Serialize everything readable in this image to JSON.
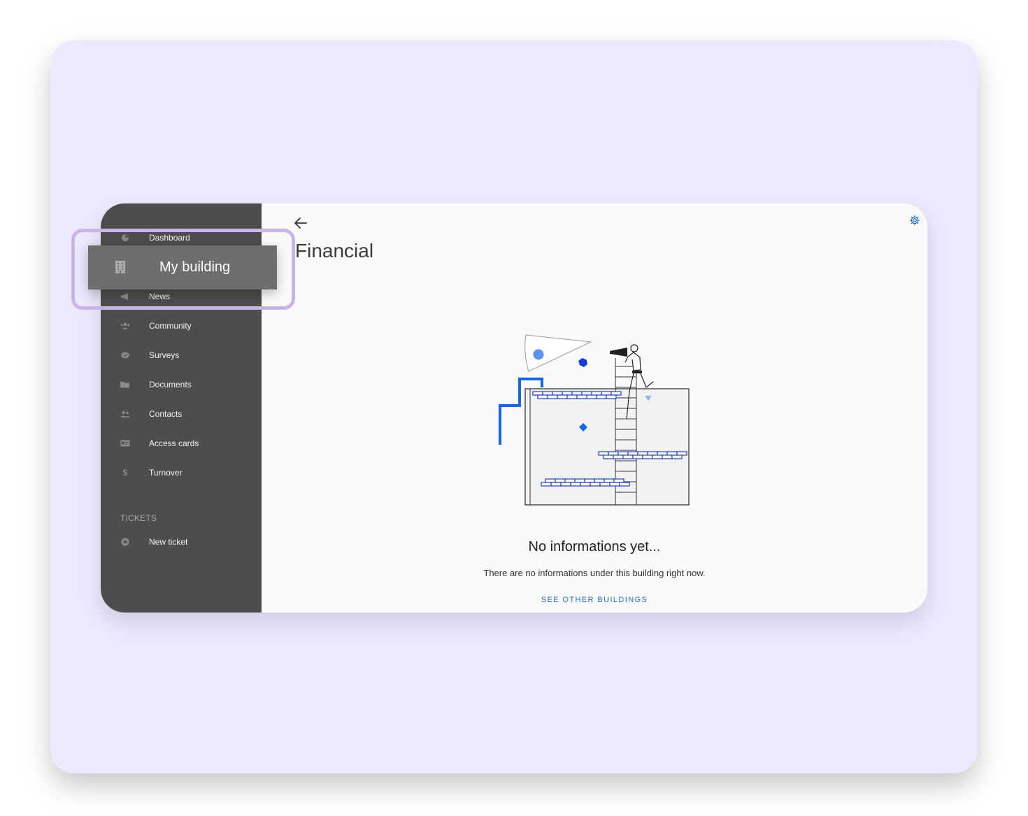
{
  "sidebar": {
    "items": [
      {
        "label": "Dashboard",
        "icon": "pie-chart-icon"
      },
      {
        "label": "My building",
        "icon": "building-icon",
        "highlighted": true
      },
      {
        "label": "News",
        "icon": "megaphone-icon"
      },
      {
        "label": "Community",
        "icon": "people-icon"
      },
      {
        "label": "Surveys",
        "icon": "chat-check-icon"
      },
      {
        "label": "Documents",
        "icon": "folder-icon"
      },
      {
        "label": "Contacts",
        "icon": "contacts-icon"
      },
      {
        "label": "Access cards",
        "icon": "id-card-icon"
      },
      {
        "label": "Turnover",
        "icon": "dollar-icon"
      }
    ],
    "tickets_section": {
      "title": "TICKETS",
      "items": [
        {
          "label": "New ticket",
          "icon": "plus-circle-icon"
        }
      ]
    }
  },
  "main": {
    "title": "Financial",
    "empty_state": {
      "title": "No informations yet...",
      "description": "There are no informations under this building right now.",
      "link_label": "SEE OTHER BUILDINGS"
    }
  },
  "colors": {
    "sidebar_bg": "#4d4d4d",
    "highlight_bg": "#6e6e6e",
    "focus_ring": "#c9b3e8",
    "page_bg": "#ece9fd",
    "accent": "#1f6fe0"
  }
}
